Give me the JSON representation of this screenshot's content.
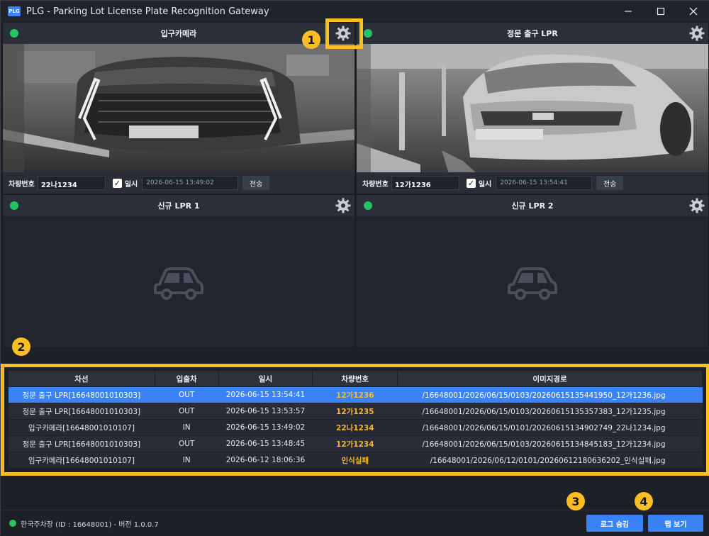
{
  "app": {
    "logo_text": "PLG",
    "title": "PLG - Parking Lot License Plate Recognition Gateway"
  },
  "window_controls": {
    "minimize": "—",
    "maximize": "☐",
    "close": "✕"
  },
  "cameras": [
    {
      "title": "입구카메라",
      "status_color": "#22c55e",
      "plate_label": "차량번호",
      "plate_value": "22나1234",
      "date_label": "일시",
      "date_value": "2026-06-15 13:49:02",
      "send_label": "전송"
    },
    {
      "title": "정문 출구 LPR",
      "status_color": "#22c55e",
      "plate_label": "차량번호",
      "plate_value": "12가1236",
      "date_label": "일시",
      "date_value": "2026-06-15 13:54:41",
      "send_label": "전송"
    },
    {
      "title": "신규 LPR 1",
      "status_color": "#22c55e"
    },
    {
      "title": "신규 LPR 2",
      "status_color": "#22c55e"
    }
  ],
  "log_table": {
    "headers": [
      "차선",
      "입출차",
      "일시",
      "차량번호",
      "이미지경로"
    ],
    "rows": [
      [
        "정문 출구 LPR[16648001010303]",
        "OUT",
        "2026-06-15 13:54:41",
        "12가1236",
        "/16648001/2026/06/15/0103/20260615135441950_12가1236.jpg"
      ],
      [
        "정문 출구 LPR[16648001010303]",
        "OUT",
        "2026-06-15 13:53:57",
        "12가1235",
        "/16648001/2026/06/15/0103/20260615135357383_12가1235.jpg"
      ],
      [
        "입구카메라[16648001010107]",
        "IN",
        "2026-06-15 13:49:02",
        "22나1234",
        "/16648001/2026/06/15/0101/20260615134902749_22나1234.jpg"
      ],
      [
        "정문 출구 LPR[16648001010303]",
        "OUT",
        "2026-06-15 13:48:45",
        "12가1234",
        "/16648001/2026/06/15/0103/20260615134845183_12가1234.jpg"
      ],
      [
        "입구카메라[16648001010107]",
        "IN",
        "2026-06-12 18:06:36",
        "인식실패",
        "/16648001/2026/06/12/0101/20260612180636202_인식실패.jpg"
      ]
    ]
  },
  "markers": [
    "1",
    "2",
    "3",
    "4"
  ],
  "footer": {
    "status_text": "한국주차장 (ID : 16648001) - 버전 1.0.0.7",
    "hide_log_label": "로그 숨김",
    "tab_view_label": "탭 보기"
  },
  "colors": {
    "accent": "#3b82f6",
    "highlight": "#fbbf24",
    "online": "#22c55e",
    "plate": "#f5b82e"
  }
}
